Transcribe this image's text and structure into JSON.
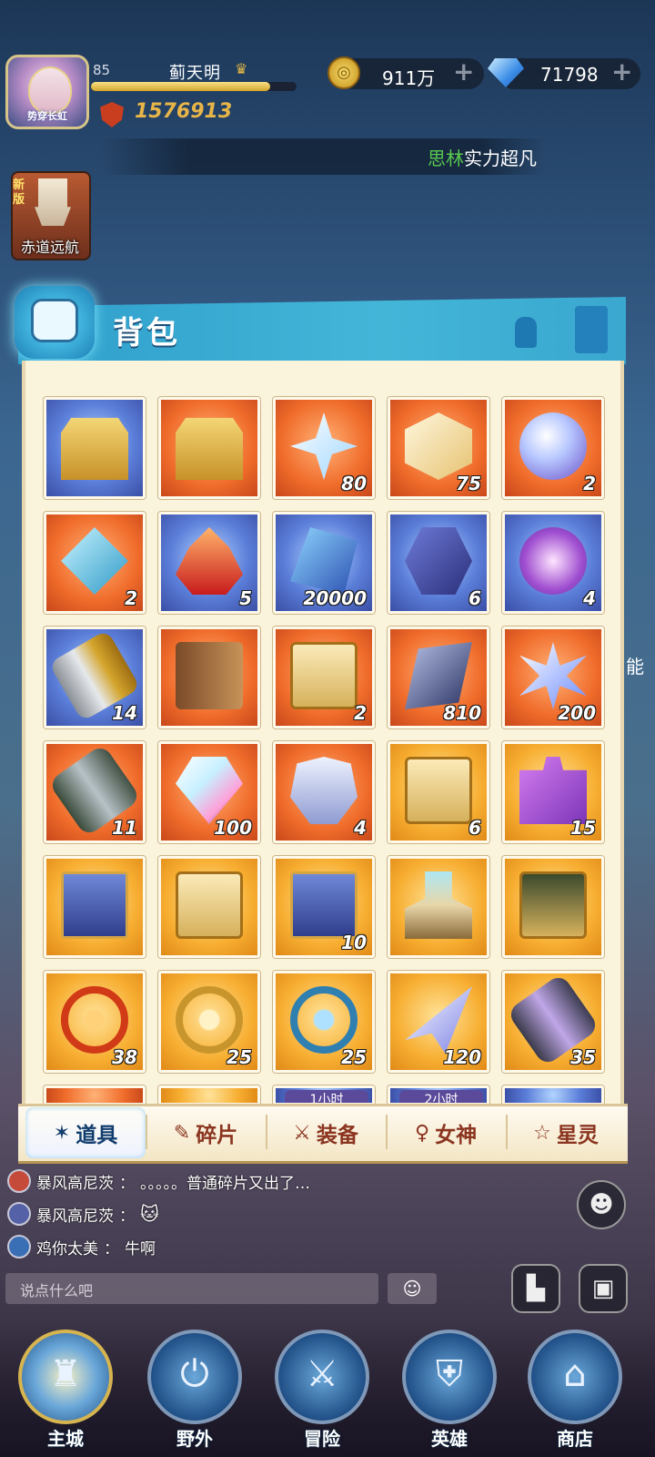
{
  "player": {
    "avatar_title": "势穿长虹",
    "level": "85",
    "name": "蓟天明",
    "power": "1576913",
    "xp_fraction": 0.87
  },
  "resources": {
    "gold": "911万",
    "gems": "71798",
    "gold_icon": "coin-icon",
    "gem_icon": "diamond-icon"
  },
  "ticker": {
    "name": "思林",
    "message": "实力超凡"
  },
  "event": {
    "badge": "新版",
    "label": "赤道远航"
  },
  "bag": {
    "title": "背包",
    "items": [
      {
        "icon": "golden-chest",
        "bg": "blue",
        "count": ""
      },
      {
        "icon": "red-chest",
        "bg": "orange",
        "count": ""
      },
      {
        "icon": "star-shard",
        "bg": "orange",
        "count": "80"
      },
      {
        "icon": "crystal-cube",
        "bg": "orange",
        "count": "75"
      },
      {
        "icon": "crystal-orb",
        "bg": "orange",
        "count": "2"
      },
      {
        "icon": "diamond-crystal",
        "bg": "orange",
        "count": "2"
      },
      {
        "icon": "flame-relic",
        "bg": "blue",
        "count": "5"
      },
      {
        "icon": "blue-crystal",
        "bg": "blue",
        "count": "20000"
      },
      {
        "icon": "hex-emblem",
        "bg": "blue",
        "count": "6"
      },
      {
        "icon": "music-rune",
        "bg": "blue",
        "count": "4"
      },
      {
        "icon": "gold-scroll",
        "bg": "blue",
        "count": "14"
      },
      {
        "icon": "mystery-cards",
        "bg": "orange",
        "count": ""
      },
      {
        "icon": "hero-card",
        "bg": "orange",
        "count": "2"
      },
      {
        "icon": "dark-shard",
        "bg": "orange",
        "count": "810"
      },
      {
        "icon": "star-burst",
        "bg": "orange",
        "count": "200"
      },
      {
        "icon": "green-scroll",
        "bg": "orange",
        "count": "11"
      },
      {
        "icon": "prism-gem",
        "bg": "orange",
        "count": "100"
      },
      {
        "icon": "silver-armor",
        "bg": "orange",
        "count": "4"
      },
      {
        "icon": "hero-card-plus",
        "bg": "gold",
        "count": "6"
      },
      {
        "icon": "puzzle-piece",
        "bg": "gold",
        "count": "15"
      },
      {
        "icon": "blue-box",
        "bg": "gold",
        "count": ""
      },
      {
        "icon": "gold-card",
        "bg": "gold",
        "count": ""
      },
      {
        "icon": "purple-box",
        "bg": "gold",
        "count": "10"
      },
      {
        "icon": "orb-altar",
        "bg": "gold",
        "count": ""
      },
      {
        "icon": "green-card",
        "bg": "gold",
        "count": ""
      },
      {
        "icon": "red-wheel",
        "bg": "gold",
        "count": "38"
      },
      {
        "icon": "gold-wheel",
        "bg": "gold",
        "count": "25"
      },
      {
        "icon": "ship-wheel",
        "bg": "gold",
        "count": "25"
      },
      {
        "icon": "crystal-blade",
        "bg": "gold",
        "count": "120"
      },
      {
        "icon": "purple-scroll",
        "bg": "gold",
        "count": "35"
      }
    ],
    "partial_row": [
      "",
      "",
      "1小时",
      "2小时",
      ""
    ],
    "tabs": [
      {
        "label": "道具",
        "icon": "props-tab-icon",
        "active": true
      },
      {
        "label": "碎片",
        "icon": "fragment-tab-icon",
        "active": false
      },
      {
        "label": "装备",
        "icon": "equipment-tab-icon",
        "active": false
      },
      {
        "label": "女神",
        "icon": "goddess-tab-icon",
        "active": false
      },
      {
        "label": "星灵",
        "icon": "star-spirit-tab-icon",
        "active": false
      }
    ]
  },
  "chat": {
    "messages": [
      {
        "user": "暴风高尼茨",
        "text": "。。。。。普通碎片又出了…"
      },
      {
        "user": "暴风高尼茨",
        "text": ""
      },
      {
        "user": "鸡你太美",
        "text": "牛啊"
      }
    ],
    "placeholder": "说点什么吧"
  },
  "side_text": "能",
  "nav": [
    "主城",
    "野外",
    "冒险",
    "英雄",
    "商店"
  ]
}
